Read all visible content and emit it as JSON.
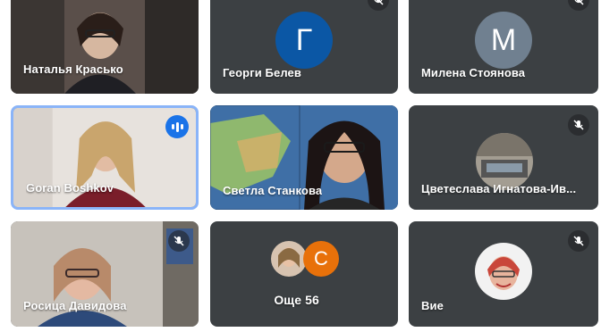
{
  "meeting": {
    "participants": [
      {
        "name": "Наталья Красько",
        "has_video": true
      },
      {
        "name": "Георги Белев",
        "has_video": false,
        "initial": "Г",
        "avatar_color": "#0b57a5",
        "muted": true
      },
      {
        "name": "Милена Стоянова",
        "has_video": false,
        "initial": "M",
        "avatar_color": "#708090",
        "muted": true
      },
      {
        "name": "Goran Boshkov",
        "has_video": true,
        "speaking": true
      },
      {
        "name": "Светла Станкова",
        "has_video": true
      },
      {
        "name": "Цветеслава Игнатова-Ив...",
        "has_video": false,
        "muted": true,
        "avatar": "photo"
      },
      {
        "name": "Росица Давидова",
        "has_video": true,
        "muted": true
      },
      {
        "name": "Вие",
        "has_video": false,
        "muted": true,
        "avatar": "photo"
      }
    ],
    "more": {
      "label": "Още 56",
      "initial": "C",
      "avatar_color": "#e8710a"
    },
    "icons": {
      "muted": "mic-off-icon",
      "speaking": "audio-level-icon"
    }
  }
}
